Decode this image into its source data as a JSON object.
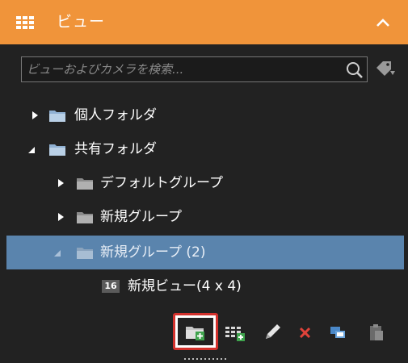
{
  "header": {
    "title": "ビュー",
    "icon": "grid-icon",
    "collapse_icon": "chevron-up-icon",
    "accent_color": "#f0943a"
  },
  "search": {
    "placeholder": "ビューおよびカメラを検索...",
    "value": ""
  },
  "tree": {
    "items": [
      {
        "label": "個人フォルダ",
        "expanded": false,
        "level": 0
      },
      {
        "label": "共有フォルダ",
        "expanded": true,
        "level": 0
      },
      {
        "label": "デフォルトグループ",
        "expanded": false,
        "level": 1
      },
      {
        "label": "新規グループ",
        "expanded": false,
        "level": 1
      },
      {
        "label": "新規グループ (2)",
        "expanded": true,
        "level": 1,
        "selected": true
      },
      {
        "label": "新規ビュー(4 x 4)",
        "badge": "16",
        "level": 2
      }
    ]
  },
  "toolbar": {
    "buttons": [
      "new-folder-icon",
      "new-view-icon",
      "edit-icon",
      "delete-icon",
      "copy-icon",
      "paste-icon"
    ],
    "highlighted": "new-folder-icon"
  },
  "colors": {
    "panel_bg": "#222222",
    "selected_row": "#5a84ad",
    "folder": "#8fb0d2",
    "highlight_border": "#d2312c"
  }
}
